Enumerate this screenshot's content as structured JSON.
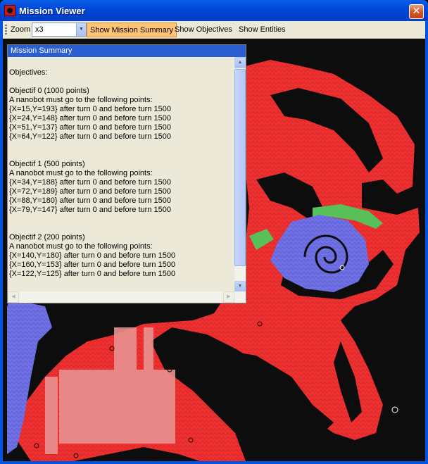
{
  "window": {
    "title": "Mission Viewer",
    "close_glyph": "✕"
  },
  "toolbar": {
    "zoom_label": "Zoom",
    "zoom_value": "x3",
    "buttons": [
      {
        "label": "Show Mission Summary",
        "active": true
      },
      {
        "label": "Show Objectives",
        "active": false
      },
      {
        "label": "Show Entities",
        "active": false
      }
    ]
  },
  "summary": {
    "title": "Mission Summary",
    "heading": "Objectives:",
    "objectives": [
      {
        "title": "Objectif 0 (1000 points)",
        "description": "A nanobot must go to the following points:",
        "points": [
          "{X=15,Y=193}  after turn 0 and before turn 1500",
          "{X=24,Y=148}  after turn 0 and before turn 1500",
          "{X=51,Y=137}  after turn 0 and before turn 1500",
          "{X=64,Y=122}  after turn 0 and before turn 1500"
        ]
      },
      {
        "title": "Objectif 1 (500 points)",
        "description": "A nanobot must go to the following points:",
        "points": [
          "{X=34,Y=188}  after turn 0 and before turn 1500",
          "{X=72,Y=189}  after turn 0 and before turn 1500",
          "{X=88,Y=180}  after turn 0 and before turn 1500",
          "{X=79,Y=147}  after turn 0 and before turn 1500"
        ]
      },
      {
        "title": "Objectif 2 (200 points)",
        "description": "A nanobot must go to the following points:",
        "points": [
          "{X=140,Y=180}  after turn 0 and before turn 1500",
          "{X=160,Y=153}  after turn 0 and before turn 1500",
          "{X=122,Y=125}  after turn 0 and before turn 1500"
        ]
      }
    ]
  },
  "colors": {
    "vessel": "#f03030",
    "dark_vessel": "#0a0a0a",
    "blue_region": "#7070e8",
    "green_region": "#58c058",
    "pink_region": "#e89090",
    "highlight_button": "#ffc478"
  },
  "icons": {
    "app": "app-icon",
    "scroll_up": "scroll-up-icon",
    "scroll_down": "scroll-down-icon"
  }
}
